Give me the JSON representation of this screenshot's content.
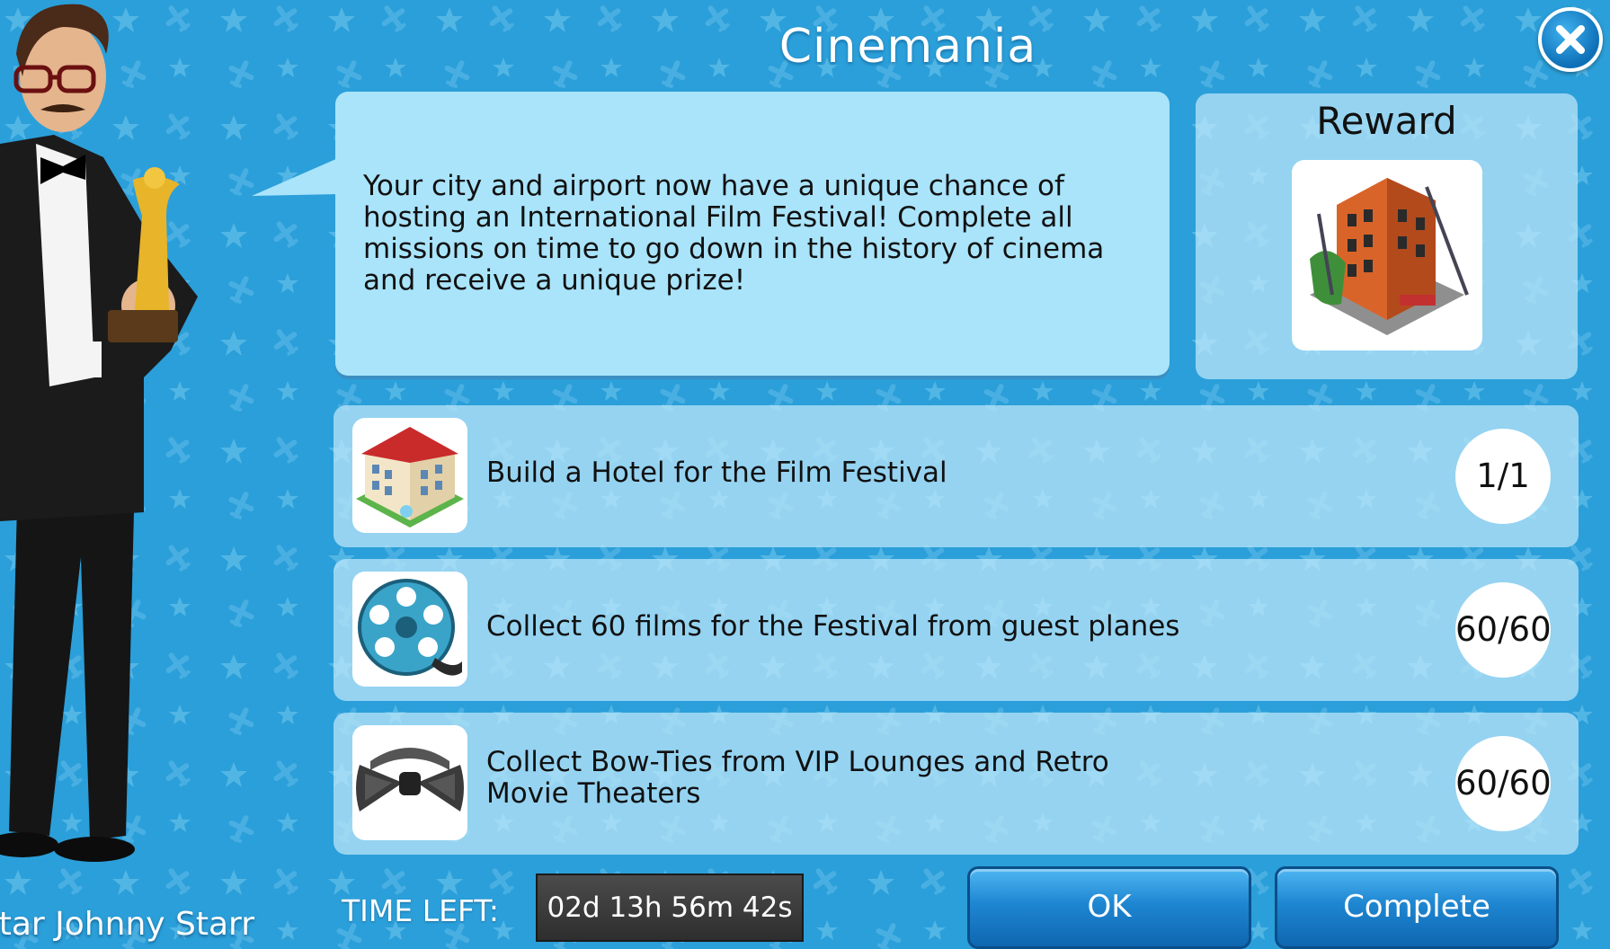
{
  "dialog": {
    "title": "Cinemania",
    "description": "Your city and airport now have a unique chance of hosting an International Film Festival! Complete all missions on time to go down in the history of cinema and receive a unique prize!"
  },
  "reward": {
    "title": "Reward",
    "image": "movie-studio-building-icon"
  },
  "missions": [
    {
      "icon": "hotel-building-icon",
      "text": "Build a Hotel for the Film Festival",
      "progress": "1/1"
    },
    {
      "icon": "film-reel-icon",
      "text": "Collect 60 films for the Festival from guest planes",
      "progress": "60/60"
    },
    {
      "icon": "bow-tie-icon",
      "text_line1": "Collect Bow-Ties from VIP Lounges and Retro",
      "text_line2": "Movie Theaters",
      "progress": "60/60"
    }
  ],
  "character": {
    "name": "star Johnny Starr",
    "icon": "movie-star-character"
  },
  "footer": {
    "time_label": "TIME LEFT:",
    "time_value": "02d 13h 56m 42s",
    "ok_label": "OK",
    "complete_label": "Complete"
  },
  "colors": {
    "background": "#2b9fd9",
    "speech_bubble": "#a9e4fb",
    "panel": "#bee8fa",
    "button": "#1e86d1",
    "timer": "#3a3a3a"
  }
}
